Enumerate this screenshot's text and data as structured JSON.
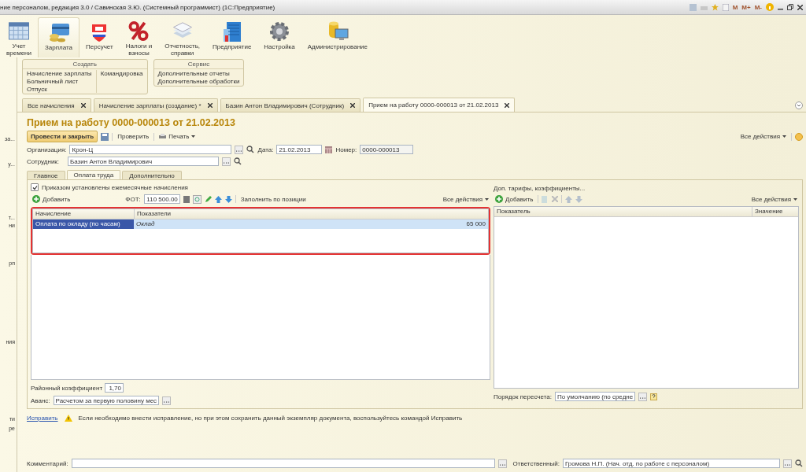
{
  "window": {
    "title": "ние персоналом, редакция 3.0 / Савинская З.Ю. (Системный программист)  (1С:Предприятие)",
    "memory_buttons": [
      "M",
      "M+",
      "M-"
    ]
  },
  "sections": [
    {
      "lines": [
        "Учет",
        "времени"
      ],
      "selected": false
    },
    {
      "lines": [
        "Зарплата"
      ],
      "selected": true
    },
    {
      "lines": [
        "Персучет"
      ],
      "selected": false
    },
    {
      "lines": [
        "Налоги и",
        "взносы"
      ],
      "selected": false
    },
    {
      "lines": [
        "Отчетность,",
        "справки"
      ],
      "selected": false
    },
    {
      "lines": [
        "Предприятие"
      ],
      "selected": false
    },
    {
      "lines": [
        "Настройка"
      ],
      "selected": false
    },
    {
      "lines": [
        "Администрирование"
      ],
      "selected": false
    }
  ],
  "left_panel": {
    "items": [
      "за...",
      "у...",
      "т...",
      "ни",
      "рп",
      "ния",
      "ти",
      "ре"
    ]
  },
  "action_groups": [
    {
      "title": "Создать",
      "columns": [
        [
          "Начисление зарплаты",
          "Больничный лист",
          "Отпуск"
        ],
        [
          "Командировка"
        ]
      ]
    },
    {
      "title": "Сервис",
      "columns": [
        [
          "Дополнительные отчеты",
          "Дополнительные обработки"
        ]
      ]
    }
  ],
  "open_tabs": [
    {
      "label": "Все начисления",
      "selected": false
    },
    {
      "label": "Начисление зарплаты (создание) *",
      "selected": false
    },
    {
      "label": "Базин Антон Владимирович (Сотрудник)",
      "selected": false
    },
    {
      "label": "Прием на работу 0000-000013 от 21.02.2013",
      "selected": true
    }
  ],
  "form": {
    "title": "Прием на работу 0000-000013 от 21.02.2013",
    "toolbar": {
      "post_close": "Провести и закрыть",
      "check": "Проверить",
      "print": "Печать",
      "all_actions": "Все действия"
    },
    "organization": {
      "label": "Организация:",
      "value": "Крон-Ц"
    },
    "date": {
      "label": "Дата:",
      "value": "21.02.2013"
    },
    "number": {
      "label": "Номер:",
      "value": "0000-000013"
    },
    "employee": {
      "label": "Сотрудник:",
      "value": "Базин Антон Владимирович"
    },
    "tabs": [
      {
        "label": "Главное",
        "selected": false
      },
      {
        "label": "Оплата труда",
        "selected": true
      },
      {
        "label": "Дополнительно",
        "selected": false
      }
    ],
    "monthly_accruals": {
      "label": "Приказом установлены ежемесячные начисления",
      "checked": true
    },
    "accruals_toolbar": {
      "add": "Добавить",
      "fot_label": "ФОТ:",
      "fot_value": "110 500.00",
      "fill": "Заполнить по позиции",
      "all_actions": "Все действия"
    },
    "accruals_table": {
      "columns": [
        "Начисление",
        "Показатели"
      ],
      "rows": [
        {
          "selected": true,
          "accrual": "Оплата по окладу (по часам)",
          "indicator": "Оклад",
          "value": "65 000"
        }
      ]
    },
    "extra": {
      "title": "Доп. тарифы, коэффициенты...",
      "add": "Добавить",
      "all_actions": "Все действия",
      "columns": [
        "Показатель",
        "Значение"
      ]
    },
    "district_coefficient": {
      "label": "Районный коэффициент",
      "value": "1,70"
    },
    "advance": {
      "label": "Аванс:",
      "value": "Расчетом за первую половину мес"
    },
    "recalc": {
      "label": "Порядок пересчета:",
      "value": "По умолчанию (по средне"
    },
    "fix": {
      "link": "Исправить",
      "message": "Если необходимо внести исправление, но при этом сохранить данный экземпляр документа, воспользуйтесь командой Исправить"
    },
    "comment": {
      "label": "Комментарий:"
    },
    "responsible": {
      "label": "Ответственный:",
      "value": "Громова Н.П. (Нач. отд. по работе с персоналом)"
    }
  }
}
